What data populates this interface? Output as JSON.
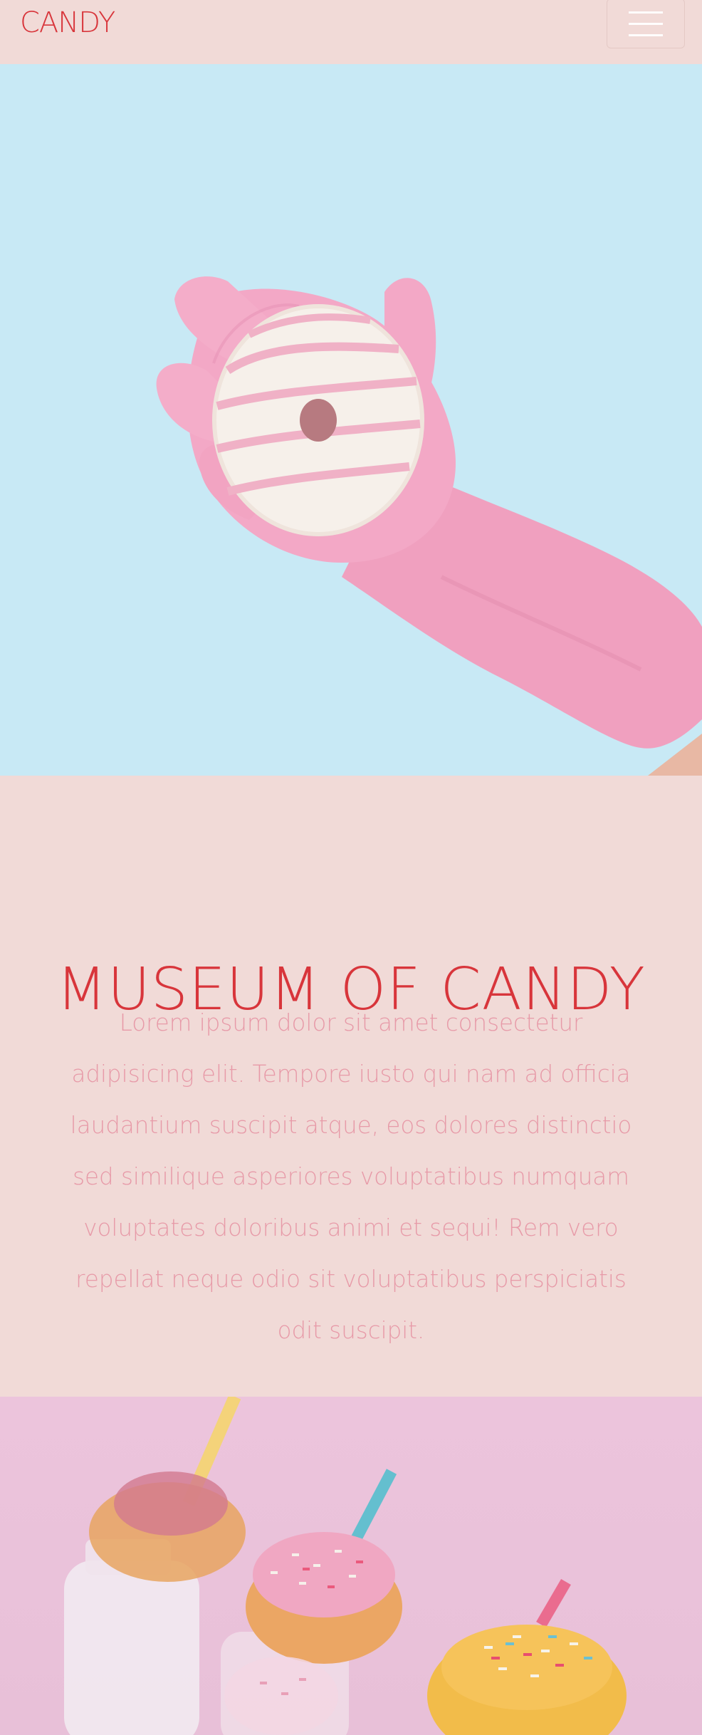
{
  "navbar": {
    "brand": "CANDY",
    "menu_icon": "hamburger-menu-icon"
  },
  "hero": {
    "image": "pink-gloved-hand-holding-glazed-donut",
    "background_color": "#c8e9f5",
    "glove_color": "#f2a6c3"
  },
  "about": {
    "title": "MUSEUM OF CANDY",
    "body": "Lorem ipsum dolor sit amet consectetur adipisicing elit. Tempore iusto qui nam ad officia laudantium suscipit atque, eos dolores distinctio sed similique asperiores voluptatibus numquam voluptates doloribus animi et sequi! Rem vero repellat neque odio sit voluptatibus perspiciatis odit suscipit."
  },
  "gallery": {
    "image": "sprinkled-donuts-on-milk-bottles-with-straws",
    "background_color": "#ecc4dc"
  },
  "colors": {
    "brand": "#d8353b",
    "text_muted": "#e79aa8",
    "page_background": "#f1dad7"
  }
}
